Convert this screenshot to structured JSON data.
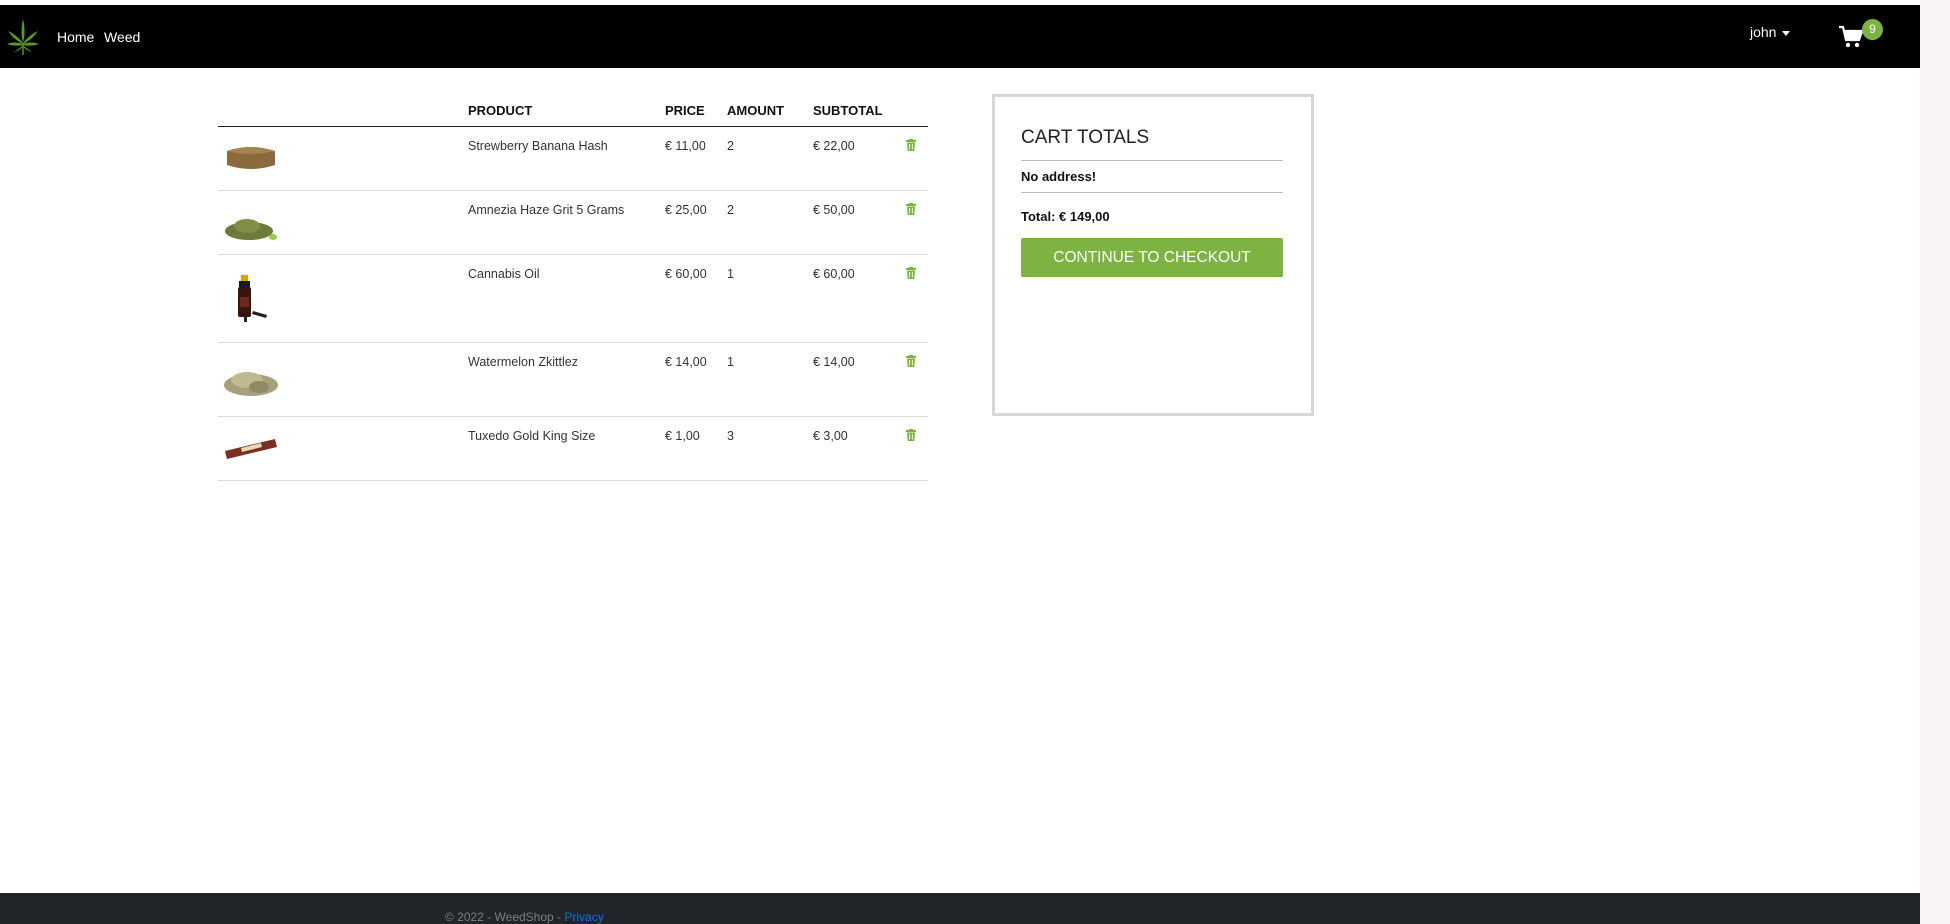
{
  "nav": {
    "brand_icon": "cannabis-leaf-icon",
    "links": [
      "Home",
      "Weed"
    ],
    "user": "john",
    "cart_icon": "cart-icon",
    "cart_count": "9"
  },
  "table": {
    "headers": {
      "product": "PRODUCT",
      "price": "PRICE",
      "amount": "AMOUNT",
      "subtotal": "SUBTOTAL"
    },
    "rows": [
      {
        "image": "hash-block-image",
        "product": "Strewberry Banana Hash",
        "price": "€ 11,00",
        "amount": "2",
        "subtotal": "€ 22,00"
      },
      {
        "image": "ground-weed-image",
        "product": "Amnezia Haze Grit 5 Grams",
        "price": "€ 25,00",
        "amount": "2",
        "subtotal": "€ 50,00"
      },
      {
        "image": "oil-bottle-image",
        "product": "Cannabis Oil",
        "price": "€ 60,00",
        "amount": "1",
        "subtotal": "€ 60,00"
      },
      {
        "image": "weed-bud-image",
        "product": "Watermelon Zkittlez",
        "price": "€ 14,00",
        "amount": "1",
        "subtotal": "€ 14,00"
      },
      {
        "image": "rolling-papers-image",
        "product": "Tuxedo Gold King Size",
        "price": "€ 1,00",
        "amount": "3",
        "subtotal": "€ 3,00"
      }
    ],
    "remove_icon": "trash-icon"
  },
  "totals": {
    "title": "CART TOTALS",
    "address": "No address!",
    "total": "Total: € 149,00",
    "checkout_label": "CONTINUE TO CHECKOUT"
  },
  "footer": {
    "text": "© 2022 - WeedShop - ",
    "link": "Privacy"
  },
  "colors": {
    "accent": "#7cb342",
    "navbar": "#000000",
    "footer": "#212529"
  }
}
